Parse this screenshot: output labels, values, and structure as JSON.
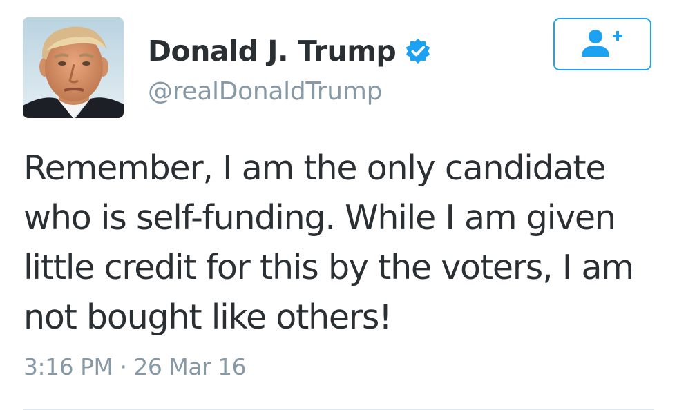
{
  "author": {
    "display_name": "Donald J. Trump",
    "handle": "@realDonaldTrump",
    "verified": true,
    "avatar_icon": "profile-photo"
  },
  "follow_button": {
    "icon": "add-user-icon",
    "accent_color": "#1da1f2"
  },
  "tweet": {
    "text_lines": [
      "Remember, I am the only candidate",
      "who is self-funding. While I am given",
      "little credit for this by the voters, I am",
      "not bought like others!"
    ],
    "timestamp": "3:16 PM · 26 Mar 16"
  },
  "colors": {
    "text": "#292f33",
    "secondary_text": "#8899a6",
    "verified_badge": "#1da1f2",
    "divider": "#e1e8ed"
  }
}
